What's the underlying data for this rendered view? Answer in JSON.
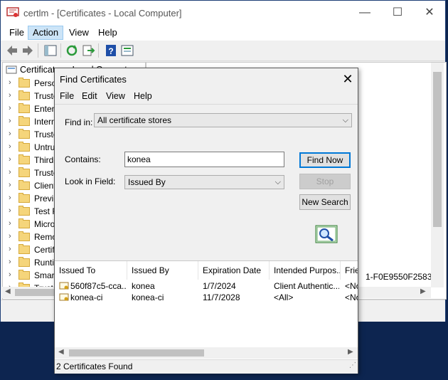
{
  "window": {
    "title": "certlm - [Certificates - Local Computer]",
    "minimize_glyph": "—",
    "maximize_glyph": "☐",
    "close_glyph": "✕"
  },
  "menubar": {
    "items": [
      "File",
      "Action",
      "View",
      "Help"
    ],
    "active": "Action"
  },
  "toolbar": {
    "icons": [
      "back-arrow-icon",
      "forward-arrow-icon",
      "show-hide-tree-icon",
      "refresh-icon",
      "export-list-icon",
      "help-icon",
      "properties-icon"
    ]
  },
  "tree": {
    "root_label": "Certificates - Local Computer",
    "items": [
      "Personal",
      "Trusted Root Certification Authorities",
      "Enterprise Trust",
      "Intermediate Certification Authorities",
      "Trusted Publishers",
      "Untrusted Certificates",
      "Third-Party Root Certification Authorities",
      "Trusted People",
      "Client Authentication Issuers",
      "Preview Build Roots",
      "Test Roots",
      "Microsoft Intune Roots",
      "Remote Desktop",
      "Certificate Enrollment Requests",
      "Runtime",
      "Smart Card Trusted Roots",
      "Trusted Devices"
    ]
  },
  "right_pane": {
    "partial_text": "1-F0E9550F2583"
  },
  "dialog": {
    "title": "Find Certificates",
    "close_glyph": "✕",
    "menu": [
      "File",
      "Edit",
      "View",
      "Help"
    ],
    "find_in_label": "Find in:",
    "find_in_value": "All certificate stores",
    "contains_label": "Contains:",
    "contains_value": "konea",
    "look_in_field_label": "Look in Field:",
    "look_in_field_value": "Issued By",
    "buttons": {
      "find_now": "Find Now",
      "stop": "Stop",
      "new_search": "New Search"
    },
    "results": {
      "columns": [
        "Issued To",
        "Issued By",
        "Expiration Date",
        "Intended Purpos...",
        "Frie"
      ],
      "rows": [
        [
          "560f87c5-cca...",
          "konea",
          "1/7/2024",
          "Client Authentic...",
          "<No"
        ],
        [
          "konea-ci",
          "konea-ci",
          "11/7/2028",
          "<All>",
          "<No"
        ]
      ]
    },
    "status": "2 Certificates Found"
  },
  "colors": {
    "desktop": "#0d2550",
    "accent": "#0078d7",
    "menu_highlight": "#cce4f7",
    "folder": "#f5d57b"
  }
}
